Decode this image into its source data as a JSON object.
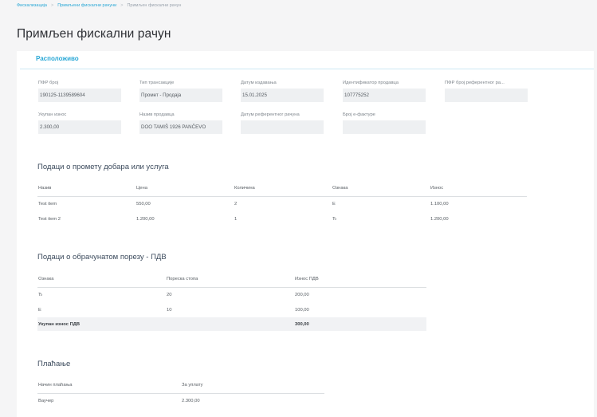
{
  "breadcrumb": {
    "items": [
      "Фискализација",
      "Примљени фискални рачуни",
      "Примљен фискални рачун"
    ]
  },
  "page": {
    "title": "Примљен фискални рачун"
  },
  "tab": {
    "label": "Расположиво"
  },
  "fields": [
    {
      "label": "ПФР број",
      "value": "190125-1139589604"
    },
    {
      "label": "Тип трансакције",
      "value": "Промет - Продаја"
    },
    {
      "label": "Датум издавања",
      "value": "15.01.2025"
    },
    {
      "label": "Идентификатор продавца",
      "value": "107775252"
    },
    {
      "label": "ПФР број референтног ра...",
      "value": ""
    },
    {
      "label": "Укупан износ",
      "value": "2.300,00"
    },
    {
      "label": "Назив продавца",
      "value": "DOO TAMIŠ 1926 PANČEVO"
    },
    {
      "label": "Датум референтног рачуна",
      "value": ""
    },
    {
      "label": "Број е-фактуре",
      "value": ""
    }
  ],
  "items_section": {
    "title": "Подаци о промету добара или услуга",
    "headers": [
      "Назив",
      "Цена",
      "Количина",
      "Ознака",
      "Износ"
    ],
    "rows": [
      [
        "Test item",
        "550,00",
        "2",
        "Е",
        "1.100,00"
      ],
      [
        "Test item 2",
        "1.200,00",
        "1",
        "Ђ",
        "1.200,00"
      ]
    ]
  },
  "tax_section": {
    "title": "Подаци о обрачунатом порезу - ПДВ",
    "headers": [
      "Ознака",
      "Пореска стопа",
      "Износ ПДВ"
    ],
    "rows": [
      [
        "Ђ",
        "20",
        "200,00"
      ],
      [
        "Е",
        "10",
        "100,00"
      ]
    ],
    "total": {
      "label": "Укупан износ ПДВ",
      "value": "300,00"
    }
  },
  "payment_section": {
    "title": "Плаћање",
    "headers": [
      "Начин плаћања",
      "За уплату"
    ],
    "rows": [
      [
        "Ваучер",
        "2.300,00"
      ]
    ]
  }
}
